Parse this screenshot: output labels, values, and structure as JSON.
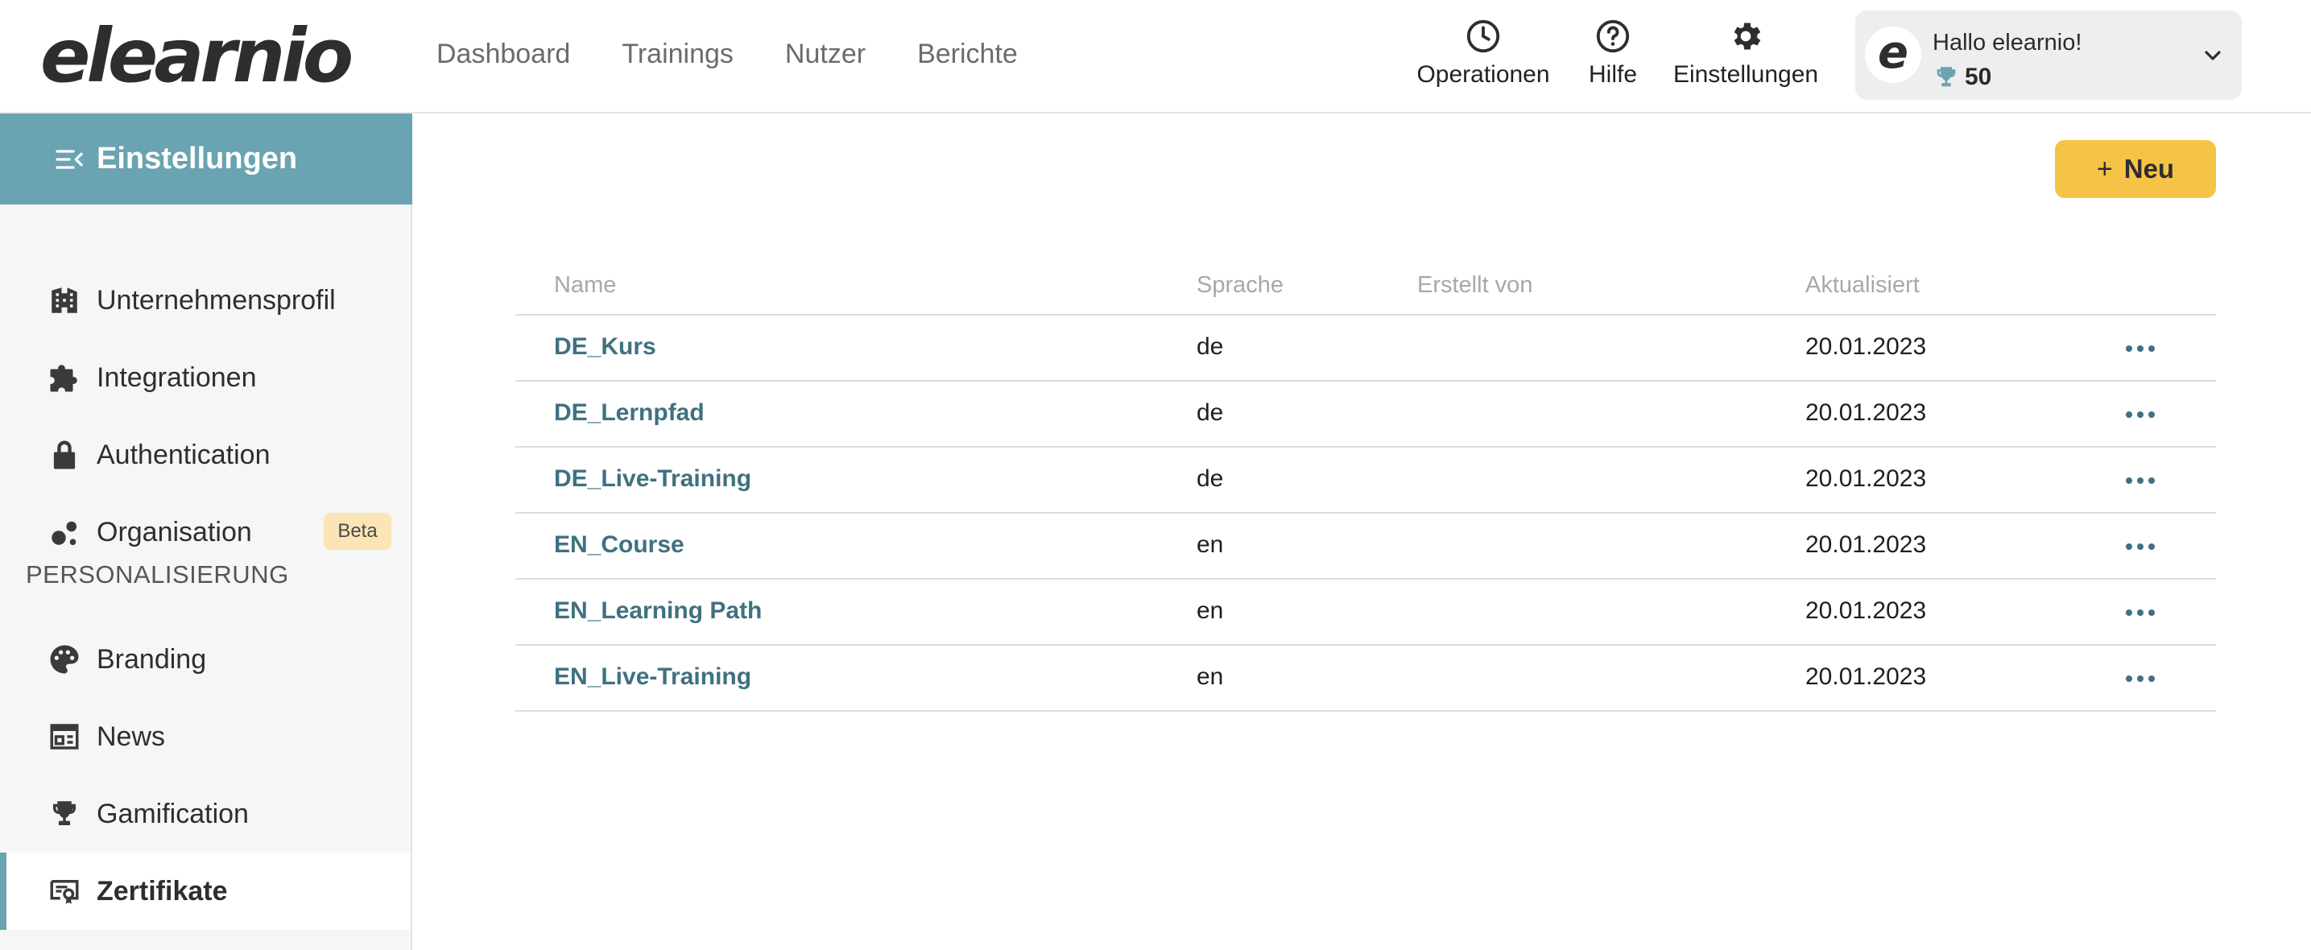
{
  "brand": {
    "logo_text": "elearnio",
    "accent": "#6aa3b1",
    "button_color": "#f5c447",
    "link_color": "#3f7180"
  },
  "nav": {
    "items": [
      {
        "label": "Dashboard"
      },
      {
        "label": "Trainings"
      },
      {
        "label": "Nutzer"
      },
      {
        "label": "Berichte"
      }
    ]
  },
  "tools": {
    "operations": {
      "label": "Operationen",
      "icon": "clock-icon"
    },
    "help": {
      "label": "Hilfe",
      "icon": "help-circle-icon"
    },
    "settings": {
      "label": "Einstellungen",
      "icon": "gear-icon"
    }
  },
  "user": {
    "avatar_letter": "e",
    "greeting": "Hallo elearnio!",
    "points": "50",
    "points_icon": "trophy-icon"
  },
  "sidebar": {
    "title": "Einstellungen",
    "items": [
      {
        "label": "Unternehmensprofil",
        "icon": "building-icon"
      },
      {
        "label": "Integrationen",
        "icon": "puzzle-icon"
      },
      {
        "label": "Authentication",
        "icon": "lock-icon"
      },
      {
        "label": "Organisation",
        "icon": "org-dots-icon",
        "badge": "Beta"
      }
    ],
    "section_label": "PERSONALISIERUNG",
    "section_items": [
      {
        "label": "Branding",
        "icon": "palette-icon"
      },
      {
        "label": "News",
        "icon": "newspaper-icon"
      },
      {
        "label": "Gamification",
        "icon": "trophy-icon"
      },
      {
        "label": "Zertifikate",
        "icon": "certificate-icon",
        "active": true
      }
    ]
  },
  "toolbar": {
    "new_label": "Neu"
  },
  "table": {
    "headers": {
      "name": "Name",
      "language": "Sprache",
      "created_by": "Erstellt von",
      "updated": "Aktualisiert"
    },
    "rows": [
      {
        "name": "DE_Kurs",
        "language": "de",
        "created_by": "",
        "updated": "20.01.2023"
      },
      {
        "name": "DE_Lernpfad",
        "language": "de",
        "created_by": "",
        "updated": "20.01.2023"
      },
      {
        "name": "DE_Live-Training",
        "language": "de",
        "created_by": "",
        "updated": "20.01.2023"
      },
      {
        "name": "EN_Course",
        "language": "en",
        "created_by": "",
        "updated": "20.01.2023"
      },
      {
        "name": "EN_Learning Path",
        "language": "en",
        "created_by": "",
        "updated": "20.01.2023"
      },
      {
        "name": "EN_Live-Training",
        "language": "en",
        "created_by": "",
        "updated": "20.01.2023"
      }
    ]
  }
}
